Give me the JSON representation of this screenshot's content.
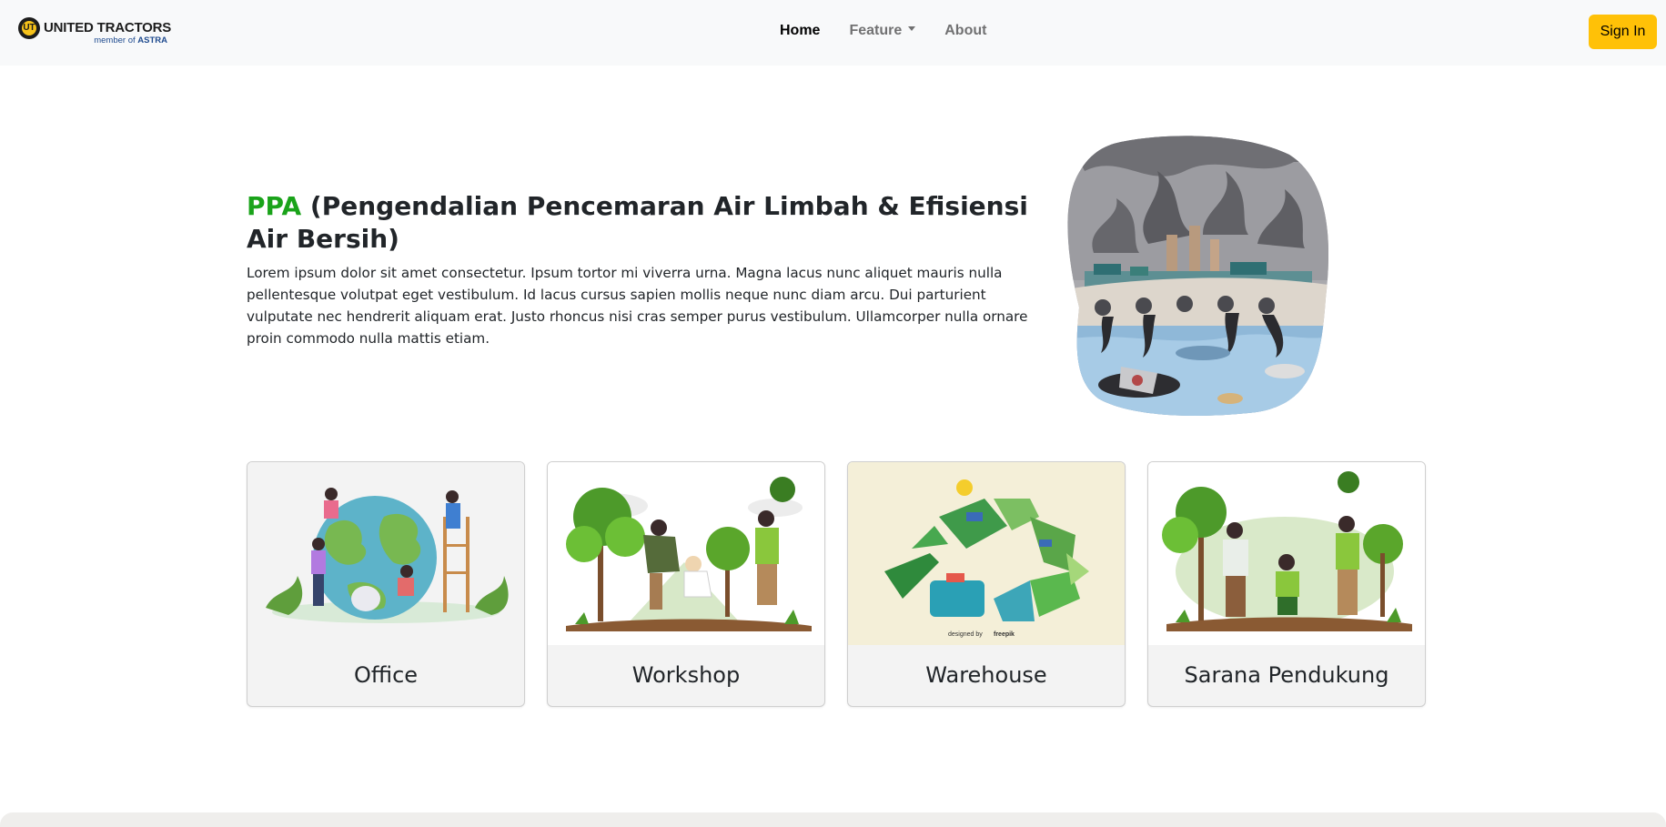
{
  "header": {
    "brand_name": "UNITED TRACTORS",
    "brand_sub_prefix": "member of",
    "brand_sub_strong": "ASTRA",
    "brand_mark": "UT",
    "nav": [
      {
        "label": "Home",
        "active": true
      },
      {
        "label": "Feature",
        "active": false,
        "dropdown": true
      },
      {
        "label": "About",
        "active": false
      }
    ],
    "signin_label": "Sign In"
  },
  "hero": {
    "title_accent": "PPA",
    "title_rest": " (Pengendalian Pencemaran Air Limbah & Efisiensi Air Bersih)",
    "text": "Lorem ipsum dolor sit amet consectetur. Ipsum tortor mi viverra urna. Magna lacus nunc aliquet mauris nulla pellentesque volutpat eget vestibulum. Id lacus cursus sapien mollis neque nunc diam arcu. Dui parturient vulputate nec hendrerit aliquam erat. Justo rhoncus nisi cras semper purus vestibulum. Ullamcorper nulla ornare proin commodo nulla mattis etiam."
  },
  "cards": [
    {
      "label": "Office"
    },
    {
      "label": "Workshop"
    },
    {
      "label": "Warehouse",
      "credit_prefix": "designed by",
      "credit_brand": "freepik"
    },
    {
      "label": "Sarana Pendukung"
    }
  ],
  "colors": {
    "accent_green": "#1aa31a",
    "signin_yellow": "#ffc107",
    "navbar_bg": "#f8f9fa"
  }
}
